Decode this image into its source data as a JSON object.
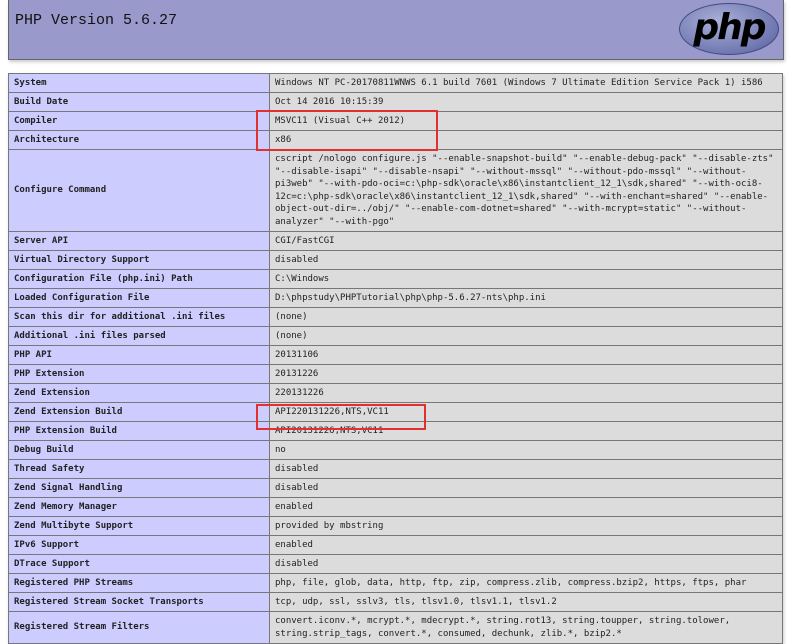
{
  "header": {
    "title": "PHP Version 5.6.27",
    "logo_text": "php"
  },
  "rows": [
    {
      "label": "System",
      "value": "Windows NT PC-20170811WNWS 6.1 build 7601 (Windows 7 Ultimate Edition Service Pack 1) i586"
    },
    {
      "label": "Build Date",
      "value": "Oct 14 2016 10:15:39"
    },
    {
      "label": "Compiler",
      "value": "MSVC11 (Visual C++ 2012)"
    },
    {
      "label": "Architecture",
      "value": "x86"
    },
    {
      "label": "Configure Command",
      "value": "cscript /nologo configure.js \"--enable-snapshot-build\" \"--enable-debug-pack\" \"--disable-zts\" \"--disable-isapi\" \"--disable-nsapi\" \"--without-mssql\" \"--without-pdo-mssql\" \"--without-pi3web\" \"--with-pdo-oci=c:\\php-sdk\\oracle\\x86\\instantclient_12_1\\sdk,shared\" \"--with-oci8-12c=c:\\php-sdk\\oracle\\x86\\instantclient_12_1\\sdk,shared\" \"--with-enchant=shared\" \"--enable-object-out-dir=../obj/\" \"--enable-com-dotnet=shared\" \"--with-mcrypt=static\" \"--without-analyzer\" \"--with-pgo\""
    },
    {
      "label": "Server API",
      "value": "CGI/FastCGI"
    },
    {
      "label": "Virtual Directory Support",
      "value": "disabled"
    },
    {
      "label": "Configuration File (php.ini) Path",
      "value": "C:\\Windows"
    },
    {
      "label": "Loaded Configuration File",
      "value": "D:\\phpstudy\\PHPTutorial\\php\\php-5.6.27-nts\\php.ini"
    },
    {
      "label": "Scan this dir for additional .ini files",
      "value": "(none)"
    },
    {
      "label": "Additional .ini files parsed",
      "value": "(none)"
    },
    {
      "label": "PHP API",
      "value": "20131106"
    },
    {
      "label": "PHP Extension",
      "value": "20131226"
    },
    {
      "label": "Zend Extension",
      "value": "220131226"
    },
    {
      "label": "Zend Extension Build",
      "value": "API220131226,NTS,VC11"
    },
    {
      "label": "PHP Extension Build",
      "value": "API20131226,NTS,VC11"
    },
    {
      "label": "Debug Build",
      "value": "no"
    },
    {
      "label": "Thread Safety",
      "value": "disabled"
    },
    {
      "label": "Zend Signal Handling",
      "value": "disabled"
    },
    {
      "label": "Zend Memory Manager",
      "value": "enabled"
    },
    {
      "label": "Zend Multibyte Support",
      "value": "provided by mbstring"
    },
    {
      "label": "IPv6 Support",
      "value": "enabled"
    },
    {
      "label": "DTrace Support",
      "value": "disabled"
    },
    {
      "label": "Registered PHP Streams",
      "value": "php, file, glob, data, http, ftp, zip, compress.zlib, compress.bzip2, https, ftps, phar"
    },
    {
      "label": "Registered Stream Socket Transports",
      "value": "tcp, udp, ssl, sslv3, tls, tlsv1.0, tlsv1.1, tlsv1.2"
    },
    {
      "label": "Registered Stream Filters",
      "value": "convert.iconv.*, mcrypt.*, mdecrypt.*, string.rot13, string.toupper, string.tolower, string.strip_tags, convert.*, consumed, dechunk, zlib.*, bzip2.*"
    }
  ],
  "colors": {
    "header": "#9999cc",
    "label_cell": "#ccccff",
    "value_cell": "#dcdcdc",
    "highlight": "#e03030"
  }
}
